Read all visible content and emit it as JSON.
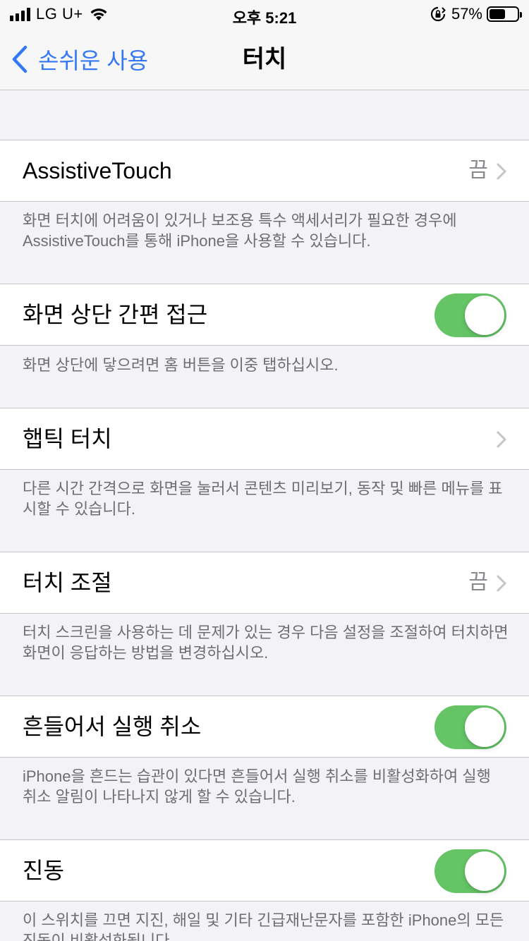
{
  "status_bar": {
    "carrier": "LG U+",
    "time": "오후 5:21",
    "battery_percent": "57%",
    "battery_level": 0.57
  },
  "nav": {
    "back_label": "손쉬운 사용",
    "title": "터치"
  },
  "settings": [
    {
      "label": "AssistiveTouch",
      "value": "끔",
      "footer": "화면 터치에 어려움이 있거나 보조용 특수 액세서리가 필요한 경우에 AssistiveTouch를 통해 iPhone을 사용할 수 있습니다."
    },
    {
      "label": "화면 상단 간편 접근",
      "toggle_on": true,
      "footer": "화면 상단에 닿으려면 홈 버튼을 이중 탭하십시오."
    },
    {
      "label": "햅틱 터치",
      "footer": "다른 시간 간격으로 화면을 눌러서 콘텐츠 미리보기, 동작 및 빠른 메뉴를 표시할 수 있습니다."
    },
    {
      "label": "터치 조절",
      "value": "끔",
      "footer": "터치 스크린을 사용하는 데 문제가 있는 경우 다음 설정을 조절하여 터치하면 화면이 응답하는 방법을 변경하십시오."
    },
    {
      "label": "흔들어서 실행 취소",
      "toggle_on": true,
      "footer": "iPhone을 흔드는 습관이 있다면 흔들어서 실행 취소를 비활성화하여 실행 취소 알림이 나타나지 않게 할 수 있습니다."
    },
    {
      "label": "진동",
      "toggle_on": true,
      "footer": "이 스위치를 끄면 지진, 해일 및 기타 긴급재난문자를 포함한 iPhone의 모든 진동이 비활성화됩니다."
    }
  ],
  "colors": {
    "accent": "#3478f6",
    "toggle_on": "#65c466",
    "background": "#f2f2f7"
  }
}
